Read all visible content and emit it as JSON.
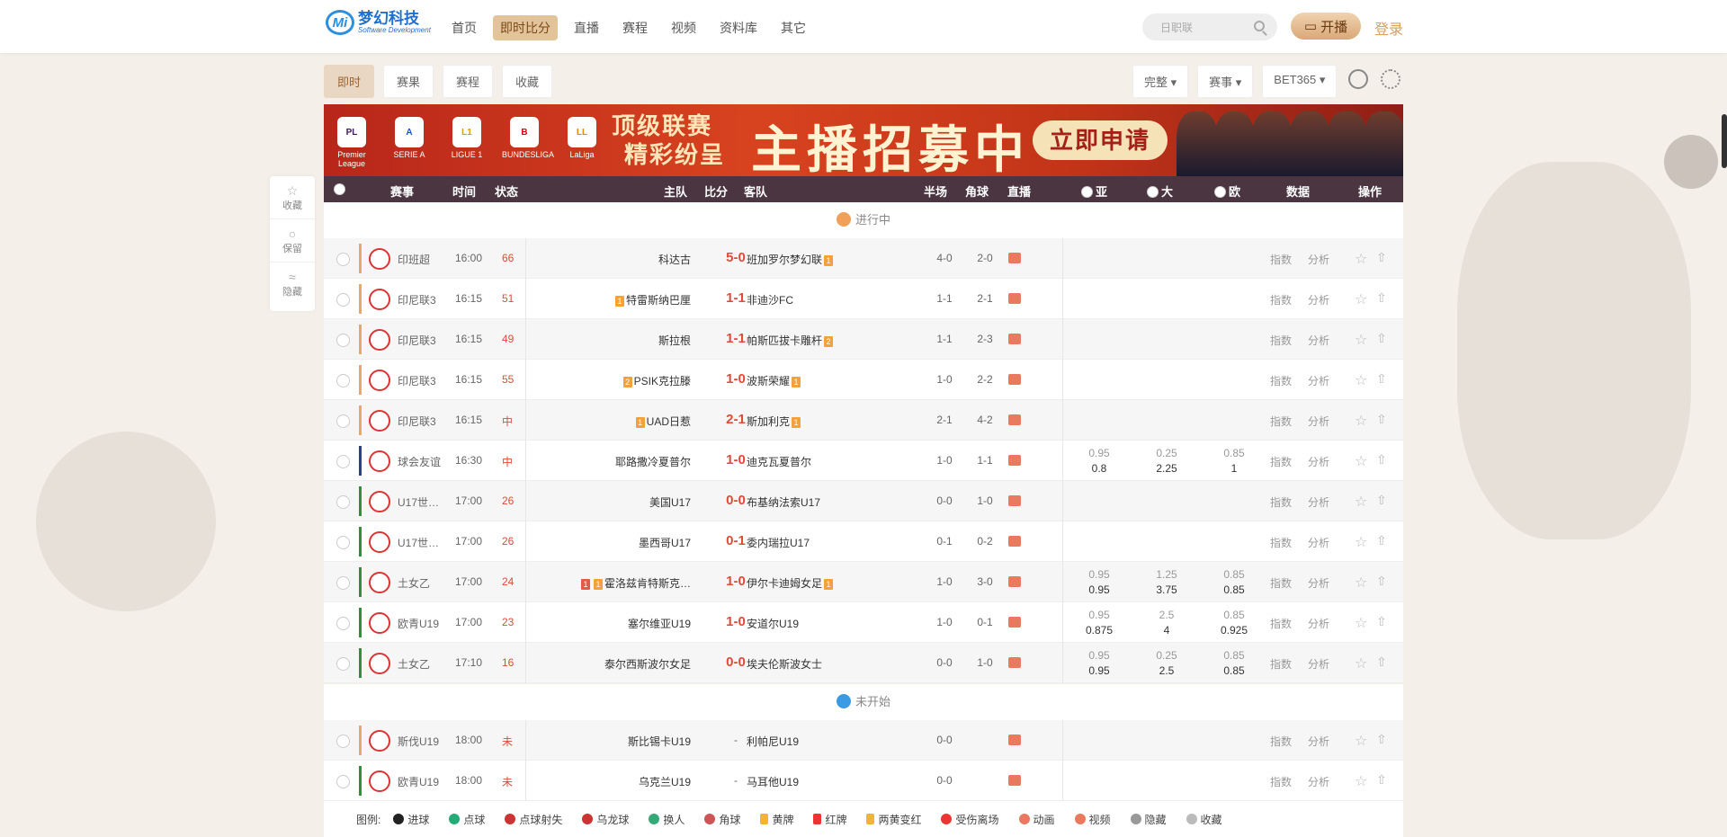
{
  "header": {
    "logo_mark": "Mi",
    "logo_name": "梦幻科技",
    "logo_sub": "Software Development",
    "nav": [
      "首页",
      "即时比分",
      "直播",
      "赛程",
      "视频",
      "资料库",
      "其它"
    ],
    "search_placeholder": "日职联",
    "live_button": "开播",
    "login": "登录"
  },
  "subtabs": [
    "即时",
    "赛果",
    "赛程",
    "收藏"
  ],
  "options": [
    "完整 ▾",
    "赛事 ▾",
    "BET365 ▾"
  ],
  "banner": {
    "leagues": [
      {
        "label": "Premier League",
        "badge": "PL"
      },
      {
        "label": "SERIE A",
        "badge": "A"
      },
      {
        "label": "LIGUE 1",
        "badge": "L1"
      },
      {
        "label": "BUNDESLIGA",
        "badge": "B"
      },
      {
        "label": "LaLiga",
        "badge": "LL"
      }
    ],
    "slogan_1": "顶级联赛",
    "slogan_2": "精彩纷呈",
    "headline": "主播招募中",
    "cta": "立即申请"
  },
  "table_headers": {
    "league": "赛事",
    "time": "时间",
    "status": "状态",
    "home": "主队",
    "score": "比分",
    "away": "客队",
    "half": "半场",
    "corner": "角球",
    "live": "直播",
    "asian": "亚",
    "big": "大",
    "euro": "欧",
    "data": "数据",
    "actions": "操作"
  },
  "sidebar": [
    "收藏",
    "保留",
    "隐藏"
  ],
  "sections": {
    "ongoing": "进行中",
    "upcoming": "未开始"
  },
  "row_actions": {
    "index": "指数",
    "analysis": "分析"
  },
  "matches": [
    {
      "league": "印班超",
      "time": "16:00",
      "status": "66",
      "home": "科达古",
      "home_badge": "",
      "score": "5-0",
      "away": "班加罗尔梦幻联",
      "away_badge": "1",
      "half": "4-0",
      "corner": "2-0",
      "odds": null
    },
    {
      "league": "印尼联3",
      "time": "16:15",
      "status": "51",
      "home": "特雷斯纳巴厘",
      "home_badge": "1",
      "score": "1-1",
      "away": "非迪沙FC",
      "away_badge": "",
      "half": "1-1",
      "corner": "2-1",
      "odds": null
    },
    {
      "league": "印尼联3",
      "time": "16:15",
      "status": "49",
      "home": "斯拉根",
      "home_badge": "",
      "score": "1-1",
      "away": "帕斯匹拔卡雕杆",
      "away_badge": "2",
      "half": "1-1",
      "corner": "2-3",
      "odds": null
    },
    {
      "league": "印尼联3",
      "time": "16:15",
      "status": "55",
      "home": "PSIK克拉滕",
      "home_badge": "2",
      "score": "1-0",
      "away": "波斯荣耀",
      "away_badge": "1",
      "half": "1-0",
      "corner": "2-2",
      "odds": null
    },
    {
      "league": "印尼联3",
      "time": "16:15",
      "status": "中",
      "home": "UAD日惹",
      "home_badge": "1",
      "score": "2-1",
      "away": "斯加利克",
      "away_badge": "1",
      "half": "2-1",
      "corner": "4-2",
      "odds": null
    },
    {
      "league": "球会友谊",
      "time": "16:30",
      "status": "中",
      "home": "耶路撒冷夏普尔",
      "home_badge": "",
      "score": "1-0",
      "away": "迪克瓦夏普尔",
      "away_badge": "",
      "half": "1-0",
      "corner": "1-1",
      "odds": [
        [
          "0.95",
          "0.8"
        ],
        [
          "0.25",
          "2.25"
        ],
        [
          "0.85",
          "1"
        ]
      ]
    },
    {
      "league": "U17世…",
      "time": "17:00",
      "status": "26",
      "home": "美国U17",
      "home_badge": "",
      "score": "0-0",
      "away": "布基纳法索U17",
      "away_badge": "",
      "half": "0-0",
      "corner": "1-0",
      "odds": null
    },
    {
      "league": "U17世…",
      "time": "17:00",
      "status": "26",
      "home": "墨西哥U17",
      "home_badge": "",
      "score": "0-1",
      "away": "委内瑞拉U17",
      "away_badge": "",
      "half": "0-1",
      "corner": "0-2",
      "odds": null
    },
    {
      "league": "土女乙",
      "time": "17:00",
      "status": "24",
      "home": "霍洛兹肯特斯克…",
      "home_badge": "1 1",
      "score": "1-0",
      "away": "伊尔卡迪姆女足",
      "away_badge": "1",
      "half": "1-0",
      "corner": "3-0",
      "odds": [
        [
          "0.95",
          "0.95"
        ],
        [
          "1.25",
          "3.75"
        ],
        [
          "0.85",
          "0.85"
        ]
      ]
    },
    {
      "league": "欧青U19",
      "time": "17:00",
      "status": "23",
      "home": "塞尔维亚U19",
      "home_badge": "",
      "score": "1-0",
      "away": "安道尔U19",
      "away_badge": "",
      "half": "1-0",
      "corner": "0-1",
      "odds": [
        [
          "0.95",
          "0.875"
        ],
        [
          "2.5",
          "4"
        ],
        [
          "0.85",
          "0.925"
        ]
      ]
    },
    {
      "league": "土女乙",
      "time": "17:10",
      "status": "16",
      "home": "泰尔西斯波尔女足",
      "home_badge": "",
      "score": "0-0",
      "away": "埃夫伦斯波女士",
      "away_badge": "",
      "half": "0-0",
      "corner": "1-0",
      "odds": [
        [
          "0.95",
          "0.95"
        ],
        [
          "0.25",
          "2.5"
        ],
        [
          "0.85",
          "0.85"
        ]
      ]
    }
  ],
  "upcoming": [
    {
      "league": "斯伐U19",
      "time": "18:00",
      "status": "未",
      "home": "斯比锡卡U19",
      "score": "-",
      "away": "利帕尼U19",
      "half": "0-0"
    },
    {
      "league": "欧青U19",
      "time": "18:00",
      "status": "未",
      "home": "乌克兰U19",
      "score": "-",
      "away": "马耳他U19",
      "half": "0-0"
    }
  ],
  "legend": {
    "title": "图例:",
    "items": [
      "进球",
      "点球",
      "点球射失",
      "乌龙球",
      "换人",
      "角球",
      "黄牌",
      "红牌",
      "两黄变红",
      "受伤离场",
      "动画",
      "视频",
      "隐藏",
      "收藏"
    ]
  },
  "colors": {
    "accent": "#e2c39a",
    "score_red": "#e04a3a",
    "header_bg": "#4a3540",
    "banner_red": "#c23418"
  }
}
